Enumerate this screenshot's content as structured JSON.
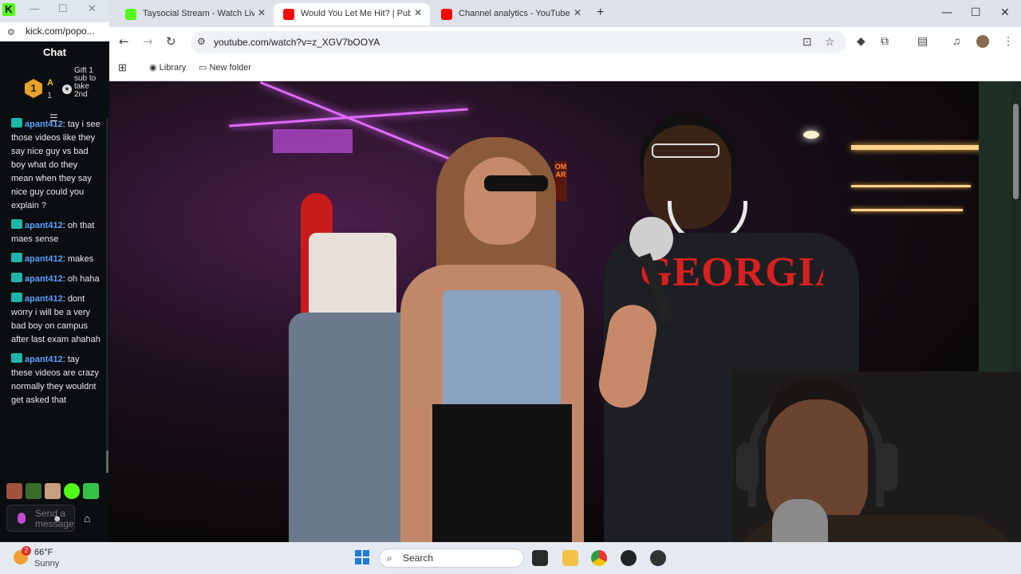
{
  "kick_window": {
    "url": "kick.com/popo...",
    "chat_title": "Chat",
    "gift": {
      "badge": "1",
      "user": "A",
      "count": "1",
      "text": "Gift 1 sub to take 2nd"
    },
    "messages": [
      {
        "user": "apant412",
        "text": ": tay i see those videos like they say nice guy vs bad boy what do they mean when they say nice guy could you explain ?"
      },
      {
        "user": "apant412",
        "text": ": oh that maes sense"
      },
      {
        "user": "apant412",
        "text": ": makes"
      },
      {
        "user": "apant412",
        "text": ": oh haha"
      },
      {
        "user": "apant412",
        "text": ": dont worry i will be a very bad boy on campus after last exam ahahah"
      },
      {
        "user": "apant412",
        "text": ": tay these videos are crazy normally they wouldnt get asked that"
      }
    ],
    "input_placeholder": "Send a message"
  },
  "browser": {
    "tabs": [
      {
        "title": "Taysocial Stream - Watch Live o",
        "active": false,
        "favicon_color": "#53fc18"
      },
      {
        "title": "Would You Let Me Hit? | Public",
        "active": true,
        "favicon_color": "#ff0000"
      },
      {
        "title": "Channel analytics - YouTube Stu",
        "active": false,
        "favicon_color": "#ff0000"
      }
    ],
    "url": "youtube.com/watch?v=z_XGV7bOOYA",
    "bookmarks": [
      {
        "label": "Library"
      },
      {
        "label": "New folder"
      }
    ]
  },
  "video": {
    "shirt_text": "GEORGIA",
    "sign_text": "OMAR"
  },
  "taskbar": {
    "weather_badge": "2",
    "temperature": "66°F",
    "condition": "Sunny",
    "search_label": "Search"
  }
}
